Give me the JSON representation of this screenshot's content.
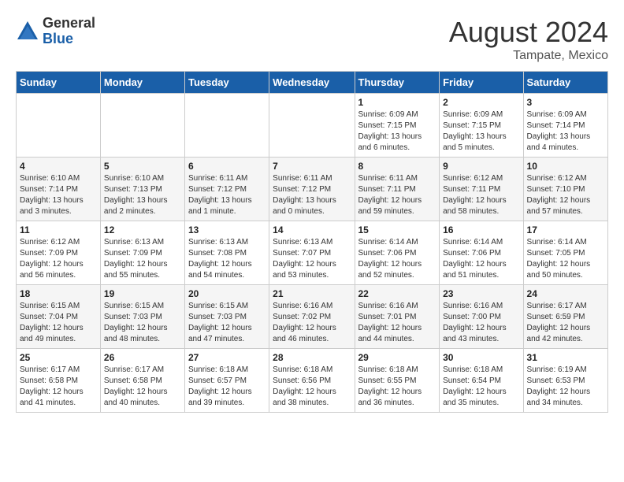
{
  "logo": {
    "general": "General",
    "blue": "Blue"
  },
  "title": {
    "month_year": "August 2024",
    "location": "Tampate, Mexico"
  },
  "days_of_week": [
    "Sunday",
    "Monday",
    "Tuesday",
    "Wednesday",
    "Thursday",
    "Friday",
    "Saturday"
  ],
  "weeks": [
    [
      {
        "day": "",
        "info": ""
      },
      {
        "day": "",
        "info": ""
      },
      {
        "day": "",
        "info": ""
      },
      {
        "day": "",
        "info": ""
      },
      {
        "day": "1",
        "info": "Sunrise: 6:09 AM\nSunset: 7:15 PM\nDaylight: 13 hours\nand 6 minutes."
      },
      {
        "day": "2",
        "info": "Sunrise: 6:09 AM\nSunset: 7:15 PM\nDaylight: 13 hours\nand 5 minutes."
      },
      {
        "day": "3",
        "info": "Sunrise: 6:09 AM\nSunset: 7:14 PM\nDaylight: 13 hours\nand 4 minutes."
      }
    ],
    [
      {
        "day": "4",
        "info": "Sunrise: 6:10 AM\nSunset: 7:14 PM\nDaylight: 13 hours\nand 3 minutes."
      },
      {
        "day": "5",
        "info": "Sunrise: 6:10 AM\nSunset: 7:13 PM\nDaylight: 13 hours\nand 2 minutes."
      },
      {
        "day": "6",
        "info": "Sunrise: 6:11 AM\nSunset: 7:12 PM\nDaylight: 13 hours\nand 1 minute."
      },
      {
        "day": "7",
        "info": "Sunrise: 6:11 AM\nSunset: 7:12 PM\nDaylight: 13 hours\nand 0 minutes."
      },
      {
        "day": "8",
        "info": "Sunrise: 6:11 AM\nSunset: 7:11 PM\nDaylight: 12 hours\nand 59 minutes."
      },
      {
        "day": "9",
        "info": "Sunrise: 6:12 AM\nSunset: 7:11 PM\nDaylight: 12 hours\nand 58 minutes."
      },
      {
        "day": "10",
        "info": "Sunrise: 6:12 AM\nSunset: 7:10 PM\nDaylight: 12 hours\nand 57 minutes."
      }
    ],
    [
      {
        "day": "11",
        "info": "Sunrise: 6:12 AM\nSunset: 7:09 PM\nDaylight: 12 hours\nand 56 minutes."
      },
      {
        "day": "12",
        "info": "Sunrise: 6:13 AM\nSunset: 7:09 PM\nDaylight: 12 hours\nand 55 minutes."
      },
      {
        "day": "13",
        "info": "Sunrise: 6:13 AM\nSunset: 7:08 PM\nDaylight: 12 hours\nand 54 minutes."
      },
      {
        "day": "14",
        "info": "Sunrise: 6:13 AM\nSunset: 7:07 PM\nDaylight: 12 hours\nand 53 minutes."
      },
      {
        "day": "15",
        "info": "Sunrise: 6:14 AM\nSunset: 7:06 PM\nDaylight: 12 hours\nand 52 minutes."
      },
      {
        "day": "16",
        "info": "Sunrise: 6:14 AM\nSunset: 7:06 PM\nDaylight: 12 hours\nand 51 minutes."
      },
      {
        "day": "17",
        "info": "Sunrise: 6:14 AM\nSunset: 7:05 PM\nDaylight: 12 hours\nand 50 minutes."
      }
    ],
    [
      {
        "day": "18",
        "info": "Sunrise: 6:15 AM\nSunset: 7:04 PM\nDaylight: 12 hours\nand 49 minutes."
      },
      {
        "day": "19",
        "info": "Sunrise: 6:15 AM\nSunset: 7:03 PM\nDaylight: 12 hours\nand 48 minutes."
      },
      {
        "day": "20",
        "info": "Sunrise: 6:15 AM\nSunset: 7:03 PM\nDaylight: 12 hours\nand 47 minutes."
      },
      {
        "day": "21",
        "info": "Sunrise: 6:16 AM\nSunset: 7:02 PM\nDaylight: 12 hours\nand 46 minutes."
      },
      {
        "day": "22",
        "info": "Sunrise: 6:16 AM\nSunset: 7:01 PM\nDaylight: 12 hours\nand 44 minutes."
      },
      {
        "day": "23",
        "info": "Sunrise: 6:16 AM\nSunset: 7:00 PM\nDaylight: 12 hours\nand 43 minutes."
      },
      {
        "day": "24",
        "info": "Sunrise: 6:17 AM\nSunset: 6:59 PM\nDaylight: 12 hours\nand 42 minutes."
      }
    ],
    [
      {
        "day": "25",
        "info": "Sunrise: 6:17 AM\nSunset: 6:58 PM\nDaylight: 12 hours\nand 41 minutes."
      },
      {
        "day": "26",
        "info": "Sunrise: 6:17 AM\nSunset: 6:58 PM\nDaylight: 12 hours\nand 40 minutes."
      },
      {
        "day": "27",
        "info": "Sunrise: 6:18 AM\nSunset: 6:57 PM\nDaylight: 12 hours\nand 39 minutes."
      },
      {
        "day": "28",
        "info": "Sunrise: 6:18 AM\nSunset: 6:56 PM\nDaylight: 12 hours\nand 38 minutes."
      },
      {
        "day": "29",
        "info": "Sunrise: 6:18 AM\nSunset: 6:55 PM\nDaylight: 12 hours\nand 36 minutes."
      },
      {
        "day": "30",
        "info": "Sunrise: 6:18 AM\nSunset: 6:54 PM\nDaylight: 12 hours\nand 35 minutes."
      },
      {
        "day": "31",
        "info": "Sunrise: 6:19 AM\nSunset: 6:53 PM\nDaylight: 12 hours\nand 34 minutes."
      }
    ]
  ]
}
